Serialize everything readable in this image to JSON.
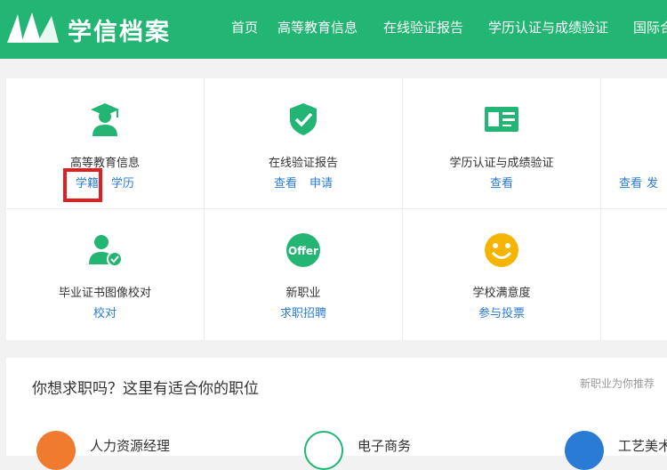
{
  "header": {
    "logo_text": "学信档案",
    "nav": [
      "首页",
      "高等教育信息",
      "在线验证报告",
      "学历认证与成绩验证",
      "国际合"
    ]
  },
  "services": [
    {
      "title": "高等教育信息",
      "links": [
        "学籍",
        "学历"
      ],
      "icon": "graduate-icon"
    },
    {
      "title": "在线验证报告",
      "links": [
        "查看",
        "申请"
      ],
      "icon": "shield-check-icon"
    },
    {
      "title": "学历认证与成绩验证",
      "links": [
        "查看"
      ],
      "icon": "certificate-card-icon"
    },
    {
      "title": "",
      "links": [
        "查看",
        "发"
      ],
      "icon": ""
    },
    {
      "title": "毕业证书图像校对",
      "links": [
        "校对"
      ],
      "icon": "user-check-icon"
    },
    {
      "title": "新职业",
      "links": [
        "求职招聘"
      ],
      "icon": "offer-icon"
    },
    {
      "title": "学校满意度",
      "links": [
        "参与投票"
      ],
      "icon": "smiley-icon"
    }
  ],
  "jobs": {
    "title": "你想求职吗？这里有适合你的职位",
    "more": "新职业为你推荐",
    "items": [
      {
        "text": "人力资源经理",
        "color": "#f07a2e"
      },
      {
        "text": "电子商务",
        "color": "#22b573"
      },
      {
        "text": "工艺美术",
        "color": "#2a7bd4"
      }
    ]
  },
  "colors": {
    "brand": "#22b573",
    "link": "#2a7bd4",
    "highlight": "#e02020",
    "smiley": "#f5b400"
  }
}
